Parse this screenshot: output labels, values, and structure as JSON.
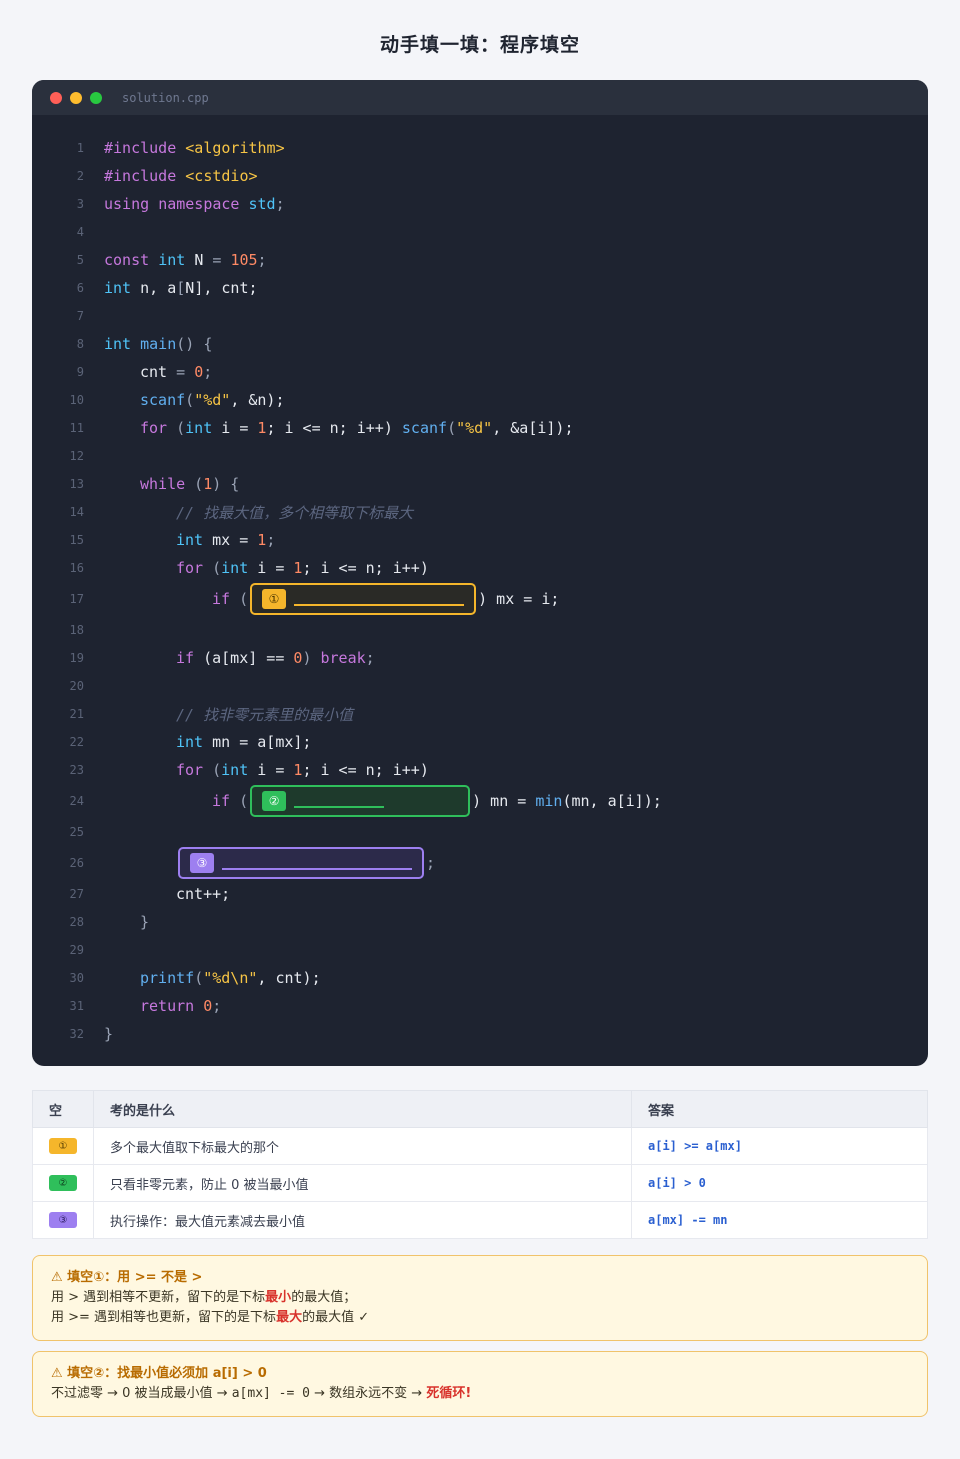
{
  "page_title": "动手填一填：程序填空",
  "editor": {
    "filename": "solution.cpp",
    "line_numbers": [
      "1",
      "2",
      "3",
      "4",
      "5",
      "6",
      "7",
      "8",
      "9",
      "10",
      "11",
      "12",
      "13",
      "14",
      "15",
      "16",
      "17",
      "18",
      "19",
      "20",
      "21",
      "22",
      "23",
      "24",
      "25",
      "26",
      "27",
      "28",
      "29",
      "30",
      "31",
      "32"
    ],
    "code": {
      "l1": [
        "#include",
        " ",
        "<algorithm>"
      ],
      "l2": [
        "#include",
        " ",
        "<cstdio>"
      ],
      "l3": [
        "using",
        " ",
        "namespace",
        " ",
        "std",
        ";"
      ],
      "l5": [
        "const",
        " ",
        "int",
        " ",
        "N",
        " = ",
        "105",
        ";"
      ],
      "l6": [
        "int",
        " ",
        "n, a",
        "[",
        "N",
        "], cnt;"
      ],
      "l8": [
        "int",
        " ",
        "main",
        "() {"
      ],
      "l9": [
        "cnt",
        " = ",
        "0",
        ";"
      ],
      "l10": [
        "scanf",
        "(",
        "\"%d\"",
        ", &n);"
      ],
      "l11": [
        "for",
        " (",
        "int",
        " i = ",
        "1",
        "; i <= n; i++) ",
        "scanf",
        "(",
        "\"%d\"",
        ", &a[i]);"
      ],
      "l13": [
        "while",
        " (",
        "1",
        ") {"
      ],
      "l14": "// 找最大值，多个相等取下标最大",
      "l15": [
        "int",
        " mx = ",
        "1",
        ";"
      ],
      "l16": [
        "for",
        " (",
        "int",
        " i = ",
        "1",
        "; i <= n; i++)"
      ],
      "l17": [
        "if",
        " (",
        ") mx = i;"
      ],
      "l19": [
        "if",
        " (a[mx] == ",
        "0",
        ") ",
        "break",
        ";"
      ],
      "l21": "// 找非零元素里的最小值",
      "l22": [
        "int",
        " mn = a[mx];"
      ],
      "l23": [
        "for",
        " (",
        "int",
        " i = ",
        "1",
        "; i <= n; i++)"
      ],
      "l24": [
        "if",
        " (",
        ") mn = ",
        "min",
        "(mn, a[i]);"
      ],
      "l26": [
        ";"
      ],
      "l27": "cnt++;",
      "l28": "}",
      "l30": [
        "printf",
        "(",
        "\"%d\\n\"",
        ", cnt);"
      ],
      "l31": [
        "return",
        " ",
        "0",
        ";"
      ],
      "l32": "}"
    },
    "blanks": {
      "b1": "①",
      "b2": "②",
      "b3": "③"
    }
  },
  "table": {
    "headers": [
      "空",
      "考的是什么",
      "答案"
    ],
    "rows": [
      {
        "badge": "①",
        "desc": "多个最大值取下标最大的那个",
        "answer": "a[i] >= a[mx]"
      },
      {
        "badge": "②",
        "desc": "只看非零元素，防止 0 被当最小值",
        "answer": "a[i] > 0"
      },
      {
        "badge": "③",
        "desc": "执行操作：最大值元素减去最小值",
        "answer": "a[mx] -= mn"
      }
    ]
  },
  "notes": [
    {
      "title": "⚠ 填空①：用 >= 不是 >",
      "line1_a": "用 > 遇到相等不更新，留下的是下标",
      "line1_b": "最小",
      "line1_c": "的最大值；",
      "line2_a": "用 >= 遇到相等也更新，留下的是下标",
      "line2_b": "最大",
      "line2_c": "的最大值 ✓"
    },
    {
      "title": "⚠ 填空②：找最小值必须加 a[i] > 0",
      "line1_a": "不过滤零 → 0 被当成最小值 → ",
      "line1_code": "a[mx] -= 0",
      "line1_b": " → 数组永远不变 → ",
      "line1_red": "死循环!"
    }
  ],
  "colors": {
    "slot1": "#f5b62b",
    "slot2": "#2fbf5b",
    "slot3": "#9d7ff0",
    "editor_bg": "#1e2330"
  }
}
